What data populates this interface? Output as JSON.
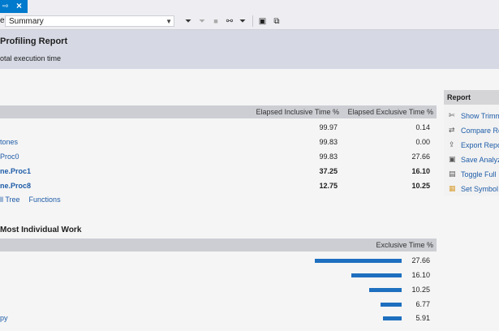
{
  "tab": {
    "pin_glyph": "⇨",
    "close_glyph": "×"
  },
  "toolbar": {
    "view_label": "e",
    "current_view": "Summary",
    "icons": [
      "filter-icon",
      "clear-filter-icon",
      "stop-icon",
      "filter-tree-icon",
      "filter-options-icon",
      "save-icon",
      "export-icon"
    ]
  },
  "header": {
    "title": "Profiling Report",
    "subtitle": "otal execution time"
  },
  "hot_path": {
    "col_inclusive": "Elapsed Inclusive Time %",
    "col_exclusive": "Elapsed Exclusive Time %",
    "rows": [
      {
        "name": "",
        "inclusive": "99.97",
        "exclusive": "0.14",
        "link": false,
        "bold": false
      },
      {
        "name": "tones",
        "inclusive": "99.83",
        "exclusive": "0.00",
        "link": true,
        "bold": false
      },
      {
        "name": "Proc0",
        "inclusive": "99.83",
        "exclusive": "27.66",
        "link": true,
        "bold": false
      },
      {
        "name": "ne.Proc1",
        "inclusive": "37.25",
        "exclusive": "16.10",
        "link": true,
        "bold": true
      },
      {
        "name": "ne.Proc8",
        "inclusive": "12.75",
        "exclusive": "10.25",
        "link": true,
        "bold": true
      }
    ],
    "links": {
      "call_tree": "ll Tree",
      "functions": "Functions"
    }
  },
  "individual_work": {
    "title": "Most Individual Work",
    "col_exclusive": "Exclusive Time %",
    "rows": [
      {
        "name": "",
        "value": 27.66,
        "label": "27.66"
      },
      {
        "name": "",
        "value": 16.1,
        "label": "16.10"
      },
      {
        "name": "",
        "value": 10.25,
        "label": "10.25"
      },
      {
        "name": "",
        "value": 6.77,
        "label": "6.77"
      },
      {
        "name": "py",
        "value": 5.91,
        "label": "5.91"
      }
    ]
  },
  "report_panel": {
    "title": "Report",
    "items": [
      {
        "label": "Show Trimm",
        "icon": "trim-icon"
      },
      {
        "label": "Compare Re",
        "icon": "compare-icon"
      },
      {
        "label": "Export Repo",
        "icon": "export-report-icon"
      },
      {
        "label": "Save Analyz",
        "icon": "save-analyzed-icon"
      },
      {
        "label": "Toggle Full",
        "icon": "toggle-full-icon"
      },
      {
        "label": "Set Symbol",
        "icon": "symbol-icon"
      }
    ]
  },
  "colors": {
    "accent": "#007acc",
    "link": "#1e5ca8",
    "bar": "#1e6fbf",
    "header_bg": "#d6d9e4"
  }
}
